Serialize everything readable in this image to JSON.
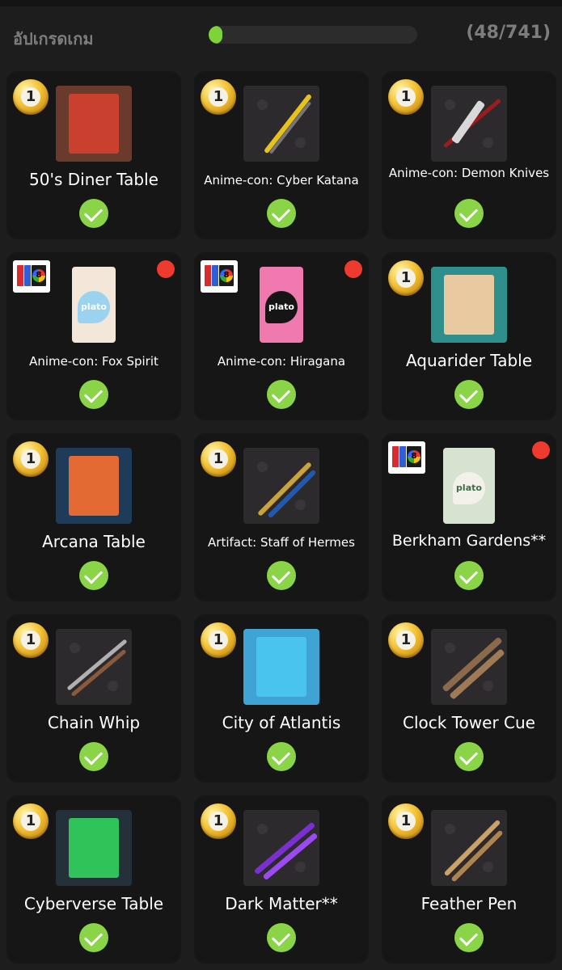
{
  "header": {
    "title": "อัปเกรดเกม",
    "progress": {
      "current": 48,
      "total": 741,
      "fraction": 0.065
    },
    "count_label": "(48/741)"
  },
  "colors": {
    "background": "#1d1d1d",
    "card": "#161616",
    "progress_fill": "#7fd33a",
    "check": "#8ad448",
    "notify_dot": "#ef3b2f",
    "header_text": "#7d7d7d"
  },
  "items": [
    {
      "name": "50's Diner Table",
      "badge": "coin",
      "badge_value": "1",
      "kind": "table",
      "checked": true,
      "new": false
    },
    {
      "name": "Anime-con: Cyber Katana",
      "badge": "coin",
      "badge_value": "1",
      "kind": "cue",
      "checked": true,
      "new": false
    },
    {
      "name": "Anime-con: Demon Knives",
      "badge": "coin",
      "badge_value": "1",
      "kind": "cue",
      "checked": true,
      "new": false
    },
    {
      "name": "Anime-con: Fox Spirit",
      "badge": "cards-icon",
      "kind": "plato-card",
      "card_logo": "plato",
      "checked": true,
      "new": true
    },
    {
      "name": "Anime-con: Hiragana",
      "badge": "cards-icon",
      "kind": "plato-card",
      "card_logo": "plato",
      "checked": true,
      "new": true
    },
    {
      "name": "Aquarider Table",
      "badge": "coin",
      "badge_value": "1",
      "kind": "table",
      "checked": true,
      "new": false
    },
    {
      "name": "Arcana Table",
      "badge": "coin",
      "badge_value": "1",
      "kind": "table",
      "checked": true,
      "new": false
    },
    {
      "name": "Artifact: Staff of Hermes",
      "badge": "coin",
      "badge_value": "1",
      "kind": "cue",
      "checked": true,
      "new": false
    },
    {
      "name": "Berkham Gardens**",
      "badge": "cards-icon",
      "kind": "plato-card",
      "card_logo": "plato",
      "checked": true,
      "new": true
    },
    {
      "name": "Chain Whip",
      "badge": "coin",
      "badge_value": "1",
      "kind": "cue",
      "checked": true,
      "new": false
    },
    {
      "name": "City of Atlantis",
      "badge": "coin",
      "badge_value": "1",
      "kind": "table",
      "checked": true,
      "new": false
    },
    {
      "name": "Clock Tower Cue",
      "badge": "coin",
      "badge_value": "1",
      "kind": "cue",
      "checked": true,
      "new": false
    },
    {
      "name": "Cyberverse Table",
      "badge": "coin",
      "badge_value": "1",
      "kind": "table",
      "checked": true,
      "new": false
    },
    {
      "name": "Dark Matter**",
      "badge": "coin",
      "badge_value": "1",
      "kind": "cue",
      "checked": true,
      "new": false
    },
    {
      "name": "Feather Pen",
      "badge": "coin",
      "badge_value": "1",
      "kind": "cue",
      "checked": true,
      "new": false
    }
  ]
}
